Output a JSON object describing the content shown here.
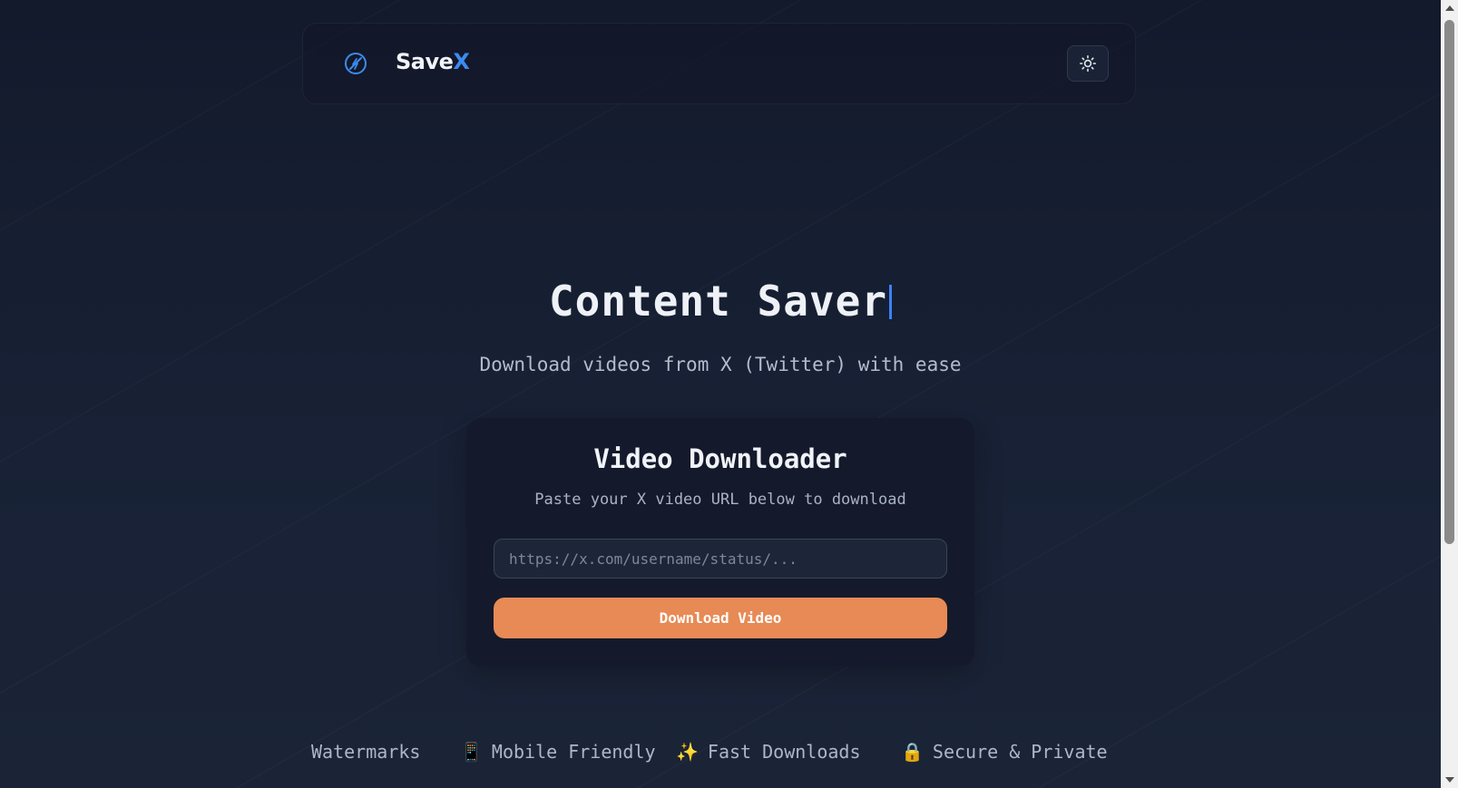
{
  "header": {
    "brand_main": "Save",
    "brand_accent": "X",
    "logo_icon": "lightning-circle-icon",
    "theme_toggle_icon": "sun-icon"
  },
  "hero": {
    "title": "Content Saver",
    "subtitle": "Download videos from X (Twitter) with ease"
  },
  "card": {
    "title": "Video Downloader",
    "subtitle": "Paste your X video URL below to download",
    "url_placeholder": "https://x.com/username/status/...",
    "download_label": "Download Video"
  },
  "features": [
    {
      "emoji": "",
      "label": "Watermarks"
    },
    {
      "emoji": "📱",
      "label": "Mobile Friendly"
    },
    {
      "emoji": "✨",
      "label": "Fast Downloads"
    },
    {
      "emoji": "🔒",
      "label": "Secure & Private"
    }
  ],
  "colors": {
    "accent": "#3b8cf0",
    "button": "#e88a55",
    "background": "#141b2e"
  }
}
